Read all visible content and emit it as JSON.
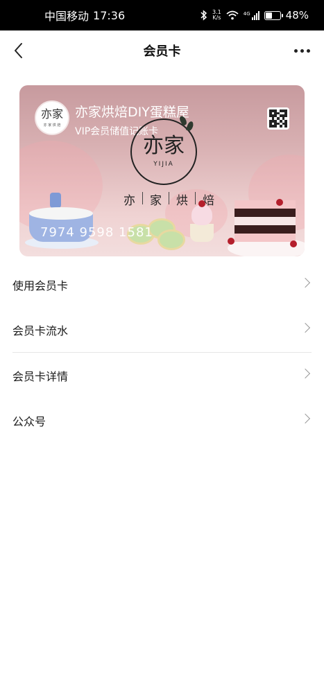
{
  "status_bar": {
    "carrier": "中国移动",
    "time": "17:36",
    "speed_value": "3.1",
    "speed_unit": "K/s",
    "network": "4G",
    "battery_text": "48%",
    "battery_level": 0.48
  },
  "nav": {
    "title": "会员卡",
    "back_icon": "chevron-left-icon",
    "more_icon": "more-dots-icon"
  },
  "card": {
    "merchant_name": "亦家烘焙DIY蛋糕屋",
    "card_type": "VIP会员储值记账卡",
    "logo_text": "亦家",
    "logo_subtext": "亦 家 烘 焙",
    "brand_text": "亦家",
    "brand_latin": "YIJIA",
    "brand_chars": [
      "亦",
      "家",
      "烘",
      "焙"
    ],
    "card_number": "7974 9598 1581",
    "qr_icon": "qr-code-icon"
  },
  "menu": {
    "items": [
      {
        "label": "使用会员卡"
      },
      {
        "label": "会员卡流水"
      },
      {
        "label": "会员卡详情"
      },
      {
        "label": "公众号"
      }
    ],
    "chevron_icon": "chevron-right-icon"
  },
  "colors": {
    "card_top": "#c79a9e",
    "card_bottom": "#f3dede",
    "text_primary": "#1a1a1a",
    "chevron": "#999999",
    "divider": "#e6e6e6"
  }
}
